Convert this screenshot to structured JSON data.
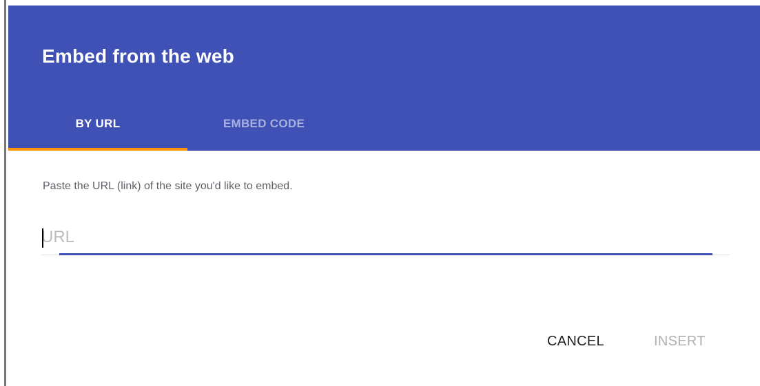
{
  "dialog": {
    "title": "Embed from the web",
    "tabs": [
      {
        "label": "BY URL",
        "active": true
      },
      {
        "label": "EMBED CODE",
        "active": false
      }
    ],
    "description": "Paste the URL (link) of the site you'd like to embed.",
    "url_field": {
      "value": "",
      "placeholder": "URL"
    },
    "actions": {
      "cancel_label": "CANCEL",
      "insert_label": "INSERT"
    }
  },
  "colors": {
    "header": "#3f51b5",
    "active_tab_indicator": "#ff9800",
    "inactive_tab_text": "#a7b0de",
    "input_underline_active": "#3f51b5",
    "disabled_button_text": "#b0b0b0"
  }
}
